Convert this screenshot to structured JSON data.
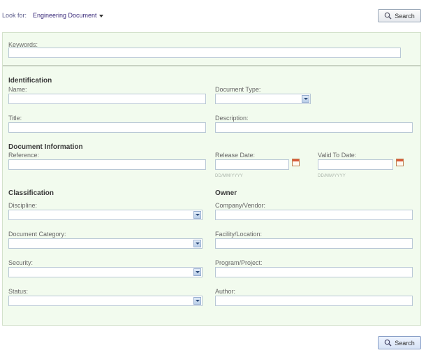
{
  "header": {
    "look_for_label": "Look for:",
    "look_for_value": "Engineering Document",
    "search_label": "Search"
  },
  "keywords": {
    "label": "Keywords:"
  },
  "identification": {
    "title": "Identification",
    "name_label": "Name:",
    "document_type_label": "Document Type:",
    "title_label": "Title:",
    "description_label": "Description:"
  },
  "document_information": {
    "title": "Document Information",
    "reference_label": "Reference:",
    "release_date_label": "Release Date:",
    "valid_to_date_label": "Valid To Date:",
    "date_hint": "DD/MM/YYYY"
  },
  "classification": {
    "title": "Classification",
    "discipline_label": "Discipline:",
    "document_category_label": "Document Category:",
    "security_label": "Security:",
    "status_label": "Status:"
  },
  "owner": {
    "title": "Owner",
    "company_label": "Company/Vendor:",
    "facility_label": "Facility/Location:",
    "program_label": "Program/Project:",
    "author_label": "Author:"
  },
  "footer": {
    "search_label": "Search"
  },
  "icons": {
    "search": "magnifier-icon",
    "calendar": "calendar-icon",
    "dropdown": "chevron-down-icon"
  }
}
